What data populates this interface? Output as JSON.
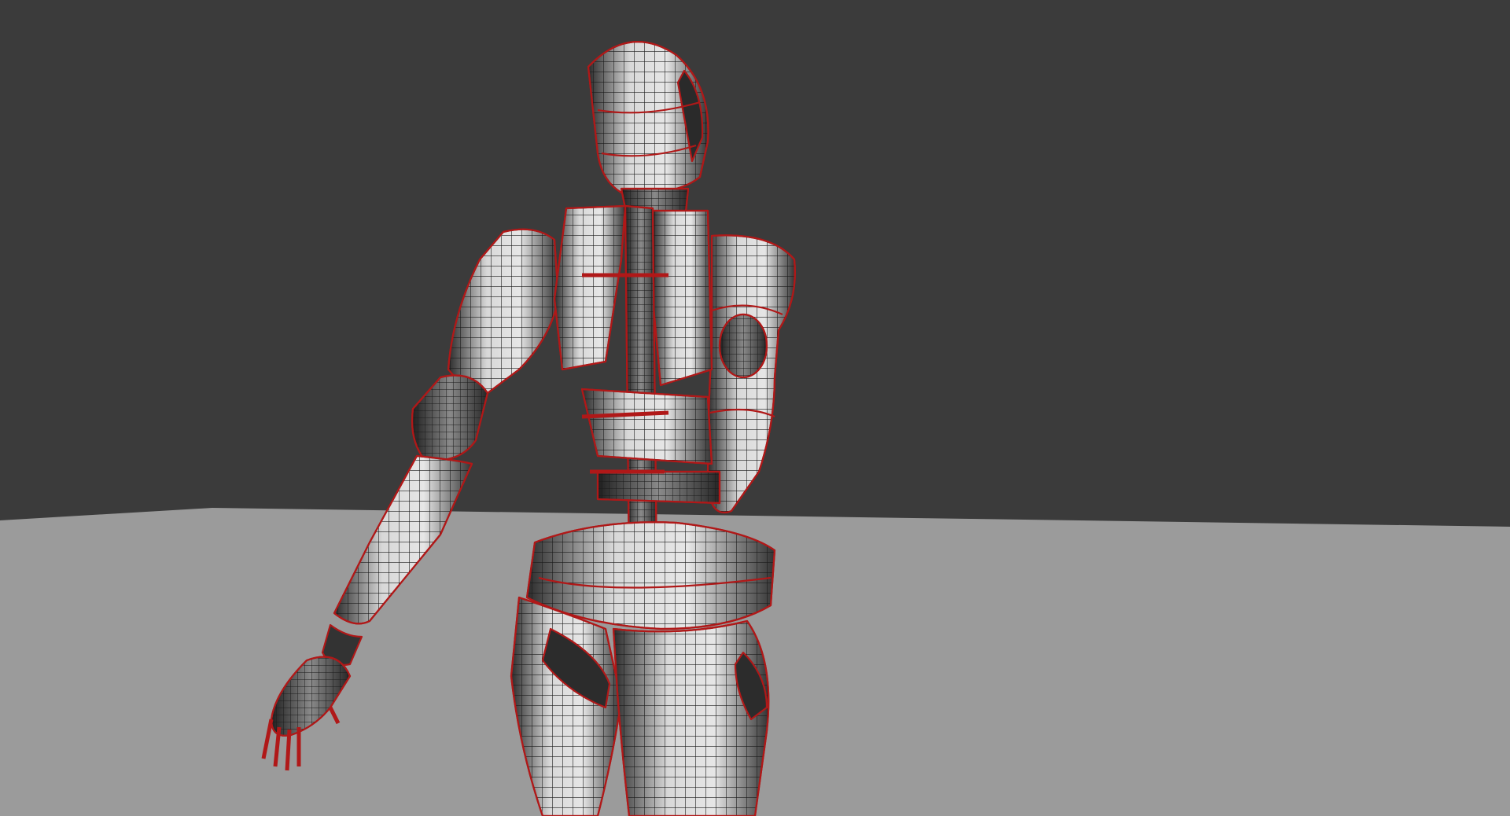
{
  "scene": {
    "colors": {
      "background": "#3b3b3b",
      "floor": "#9b9b9b",
      "mesh_fill": "#d9d9d9",
      "mesh_shadow": "#2a2a2a",
      "wire": "#1a1a1a",
      "edge_highlight": "#b01818"
    },
    "subject": "wireframe-robot-figure"
  }
}
